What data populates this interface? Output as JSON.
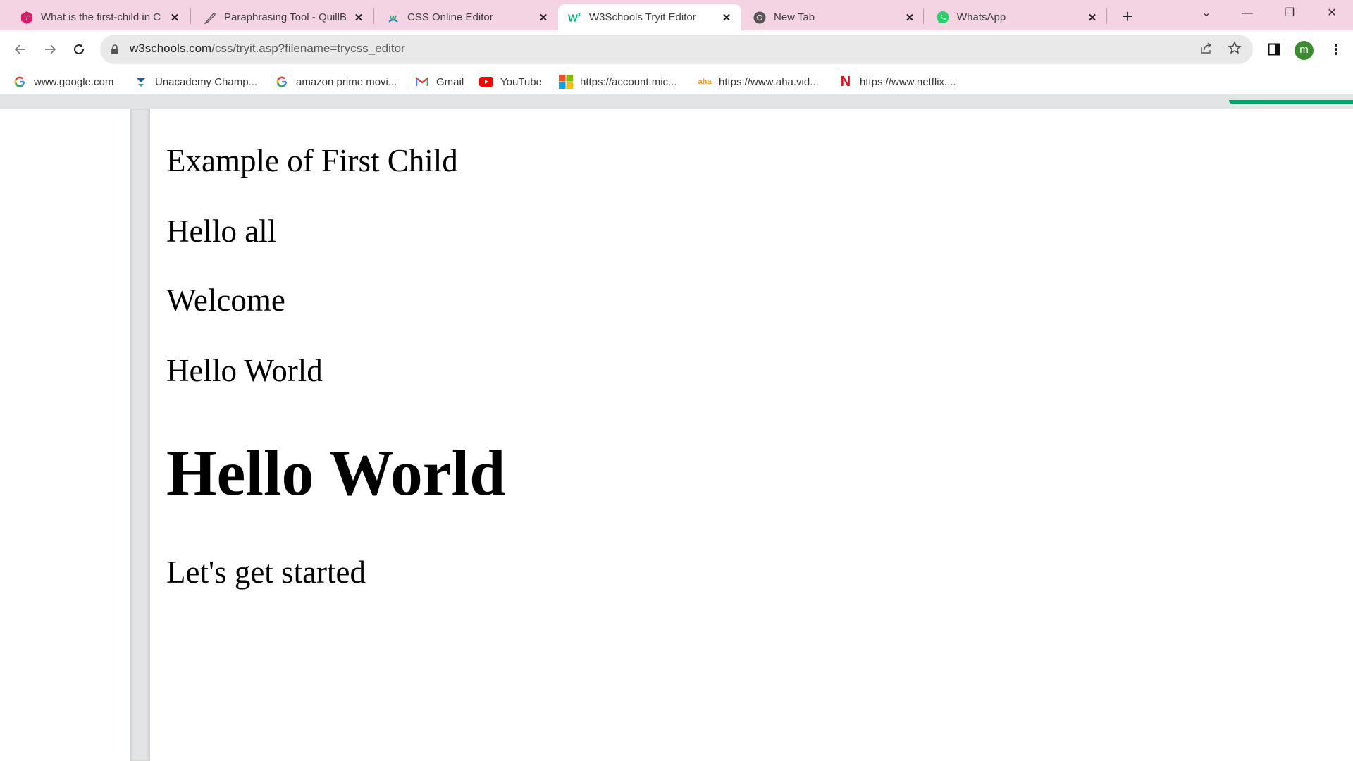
{
  "browser": {
    "tabs": [
      {
        "title": "What is the first-child in C",
        "icon": "tutorial-red-icon",
        "active": false
      },
      {
        "title": "Paraphrasing Tool - QuillB",
        "icon": "feather-icon",
        "active": false
      },
      {
        "title": "CSS Online Editor",
        "icon": "w-editor-icon",
        "active": false
      },
      {
        "title": "W3Schools Tryit Editor",
        "icon": "w3schools-icon",
        "active": true
      },
      {
        "title": "New Tab",
        "icon": "chrome-icon",
        "active": false
      },
      {
        "title": "WhatsApp",
        "icon": "whatsapp-icon",
        "active": false
      }
    ],
    "close_glyph": "✕",
    "new_tab_glyph": "+",
    "window_controls": {
      "tab_search": "⌄",
      "minimize": "—",
      "restore": "❐",
      "close": "✕"
    },
    "address": {
      "host": "w3schools.com",
      "path": "/css/tryit.asp?filename=trycss_editor"
    },
    "profile_initial": "m",
    "bookmarks": [
      {
        "label": "www.google.com",
        "icon": "google-icon"
      },
      {
        "label": "Unacademy Champ...",
        "icon": "unacademy-icon"
      },
      {
        "label": "amazon prime movi...",
        "icon": "google-icon"
      },
      {
        "label": "Gmail",
        "icon": "gmail-icon"
      },
      {
        "label": "YouTube",
        "icon": "youtube-icon"
      },
      {
        "label": "https://account.mic...",
        "icon": "microsoft-icon"
      },
      {
        "label": "https://www.aha.vid...",
        "icon": "aha-icon"
      },
      {
        "label": "https://www.netflix....",
        "icon": "netflix-icon"
      }
    ]
  },
  "result": {
    "heading_example": "Example of First Child",
    "p1": "Hello all",
    "p2": "Welcome",
    "p3": "Hello World",
    "h1": "Hello World",
    "last": "Let's get started"
  },
  "colors": {
    "accent_red": "#ff0000",
    "w3_green": "#04a36b",
    "tabbar_pink": "#f4d3e3"
  }
}
